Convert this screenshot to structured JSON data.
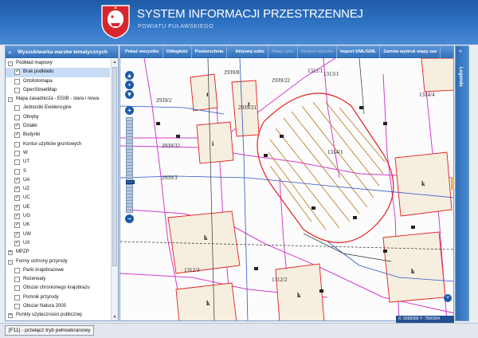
{
  "header": {
    "title": "SYSTEM INFORMACJI PRZESTRZENNEJ",
    "subtitle": "POWIATU PUŁAWSKIEGO",
    "crest_icon": "coat-of-arms-icon",
    "colors": {
      "bar": "#2f74c4",
      "title": "#ffffff"
    }
  },
  "left_panel": {
    "title": "Wyszukiwarka warstw tematycznych",
    "tree": [
      {
        "label": "Podkład mapowy",
        "level": 0,
        "twisty": "-",
        "checked": null
      },
      {
        "label": "Brak podkładu",
        "level": 1,
        "checked": true,
        "selected": true
      },
      {
        "label": "Ortofotomapa",
        "level": 1,
        "checked": false
      },
      {
        "label": "OpenStreetMap",
        "level": 1,
        "checked": false
      },
      {
        "label": "Mapa zasadnicza - EGIB - stara i nowa",
        "level": 0,
        "twisty": "-",
        "checked": null
      },
      {
        "label": "Jednostki Ewidencyjne",
        "level": 1,
        "checked": false
      },
      {
        "label": "Obręby",
        "level": 1,
        "checked": false
      },
      {
        "label": "Działki",
        "level": 1,
        "checked": true
      },
      {
        "label": "Budynki",
        "level": 1,
        "checked": true
      },
      {
        "label": "Kontur użytków gruntowych",
        "level": 1,
        "checked": false
      },
      {
        "label": "W",
        "level": 1,
        "checked": false
      },
      {
        "label": "UT",
        "level": 1,
        "checked": false
      },
      {
        "label": "S",
        "level": 1,
        "checked": false
      },
      {
        "label": "UA",
        "level": 1,
        "checked": true
      },
      {
        "label": "UZ",
        "level": 1,
        "checked": true
      },
      {
        "label": "UC",
        "level": 1,
        "checked": true
      },
      {
        "label": "UE",
        "level": 1,
        "checked": true
      },
      {
        "label": "UG",
        "level": 1,
        "checked": true
      },
      {
        "label": "UK",
        "level": 1,
        "checked": true
      },
      {
        "label": "UW",
        "level": 1,
        "checked": true
      },
      {
        "label": "UX",
        "level": 1,
        "checked": true
      },
      {
        "label": "MPZP",
        "level": 0,
        "twisty": "+",
        "checked": null
      },
      {
        "label": "Formy ochrony przyrody",
        "level": 0,
        "twisty": "-",
        "checked": null
      },
      {
        "label": "Parki krajobrazowe",
        "level": 1,
        "checked": false
      },
      {
        "label": "Rezerwaty",
        "level": 1,
        "checked": false
      },
      {
        "label": "Obszar chronionego krajobrazu",
        "level": 1,
        "checked": false
      },
      {
        "label": "Pomnik przyrody",
        "level": 1,
        "checked": false
      },
      {
        "label": "Obszar Natura 2000",
        "level": 1,
        "checked": false
      },
      {
        "label": "Punkty użyteczności publicznej",
        "level": 0,
        "twisty": "+",
        "checked": null
      }
    ]
  },
  "map_toolbar": {
    "buttons": [
      {
        "label": "Pokaż wszystko",
        "enabled": true
      },
      {
        "label": "Odległość",
        "enabled": true
      },
      {
        "label": "Powierzchnia",
        "enabled": true
      },
      {
        "label": "Aktywuj szkic",
        "enabled": true
      },
      {
        "label": "Nowy szkic",
        "enabled": false
      },
      {
        "label": "Eksport szkiców",
        "enabled": false
      },
      {
        "label": "Import KML/GML",
        "enabled": true
      },
      {
        "label": "Zamów wydruk mapy zas",
        "enabled": true
      }
    ]
  },
  "map": {
    "parcel_labels": [
      "2939/8",
      "2939/2",
      "2939/22",
      "2939/32",
      "2939/3",
      "2939/21",
      "1313/1",
      "1311/1",
      "1314/4",
      "1314/1",
      "1312/3",
      "1312/2"
    ],
    "building_labels": [
      "t",
      "t",
      "i",
      "k",
      "k",
      "k",
      "k",
      "k"
    ],
    "coordinates": "X: 5698389  Y: 7566904"
  },
  "legend": {
    "label": "Legenda"
  },
  "statusbar": {
    "fullscreen_label": "[F11] - przełącz tryb pełnoekranowy"
  }
}
